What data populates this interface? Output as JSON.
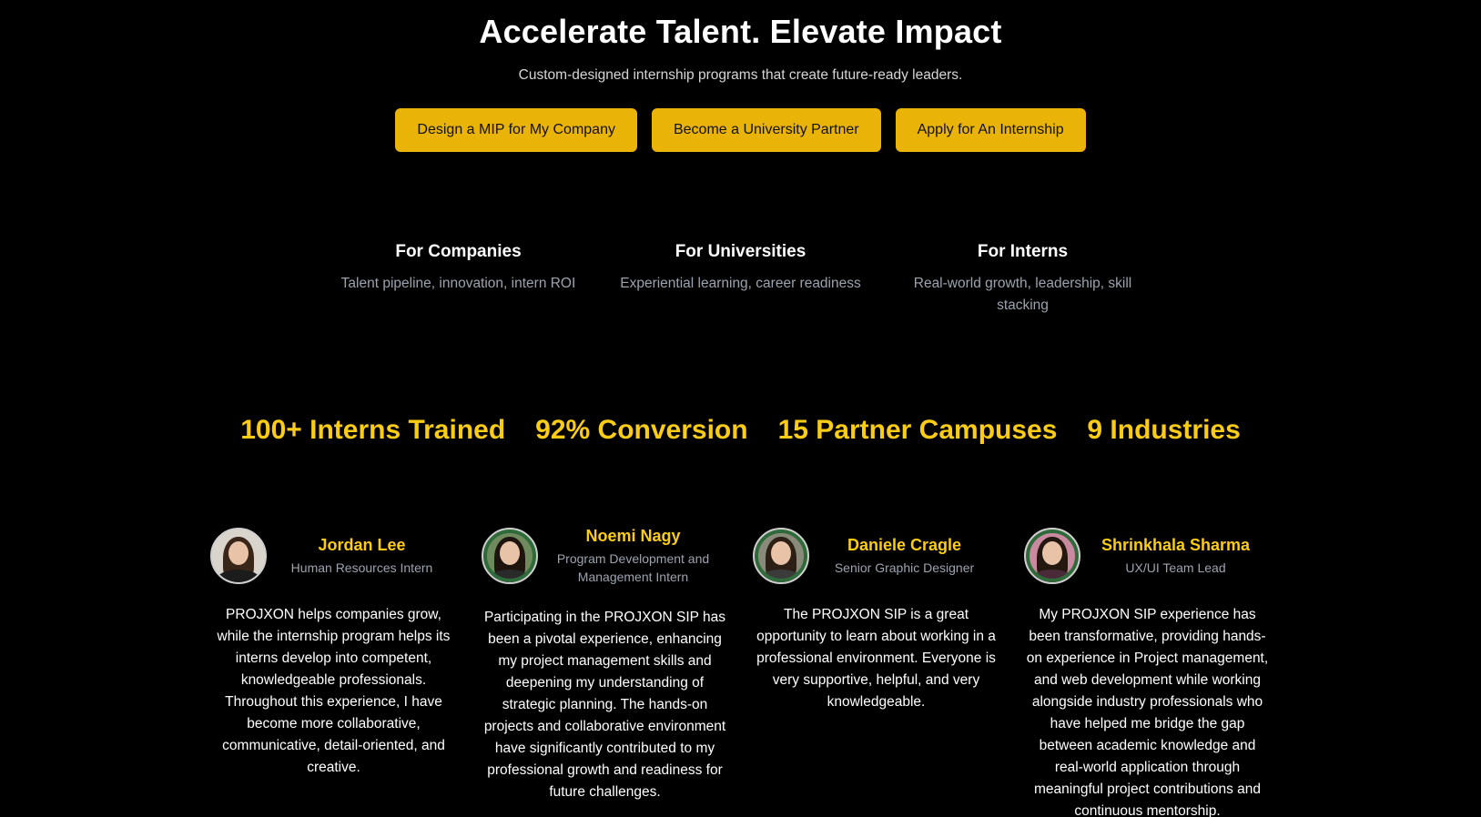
{
  "hero": {
    "title": "Accelerate Talent. Elevate Impact",
    "subtitle": "Custom-designed internship programs that create future-ready leaders.",
    "buttons": [
      {
        "label": "Design a MIP for My Company"
      },
      {
        "label": "Become a University Partner"
      },
      {
        "label": "Apply for An Internship"
      }
    ]
  },
  "audiences": [
    {
      "title": "For Companies",
      "description": "Talent pipeline, innovation, intern ROI"
    },
    {
      "title": "For Universities",
      "description": "Experiential learning, career readiness"
    },
    {
      "title": "For Interns",
      "description": "Real-world growth, leadership, skill stacking"
    }
  ],
  "stats": [
    {
      "text": "100+ Interns Trained"
    },
    {
      "text": "92% Conversion"
    },
    {
      "text": "15 Partner Campuses"
    },
    {
      "text": "9 Industries"
    }
  ],
  "testimonials": [
    {
      "name": "Jordan Lee",
      "role": "Human Resources Intern",
      "quote": "PROJXON helps companies grow, while the internship program helps its interns develop into competent, knowledgeable professionals. Throughout this experience, I have become more collaborative, communicative, detail-oriented, and creative."
    },
    {
      "name": "Noemi Nagy",
      "role": "Program Development and Management Intern",
      "quote": "Participating in the PROJXON SIP has been a pivotal experience, enhancing my project management skills and deepening my understanding of strategic planning. The hands-on projects and collaborative environment have significantly contributed to my professional growth and readiness for future challenges."
    },
    {
      "name": "Daniele Cragle",
      "role": "Senior Graphic Designer",
      "quote": "The PROJXON SIP is a great opportunity to learn about working in a professional environment. Everyone is very supportive, helpful, and very knowledgeable."
    },
    {
      "name": "Shrinkhala Sharma",
      "role": "UX/UI Team Lead",
      "quote": "My PROJXON SIP experience has been transformative, providing hands-on experience in Project management, and web development while working alongside industry professionals who have helped me bridge the gap between academic knowledge and real-world application through meaningful project contributions and continuous mentorship."
    }
  ],
  "colors": {
    "background": "#000000",
    "accent": "#EAB308",
    "stat_yellow": "#FACC15",
    "muted_text": "#9ca3af"
  }
}
